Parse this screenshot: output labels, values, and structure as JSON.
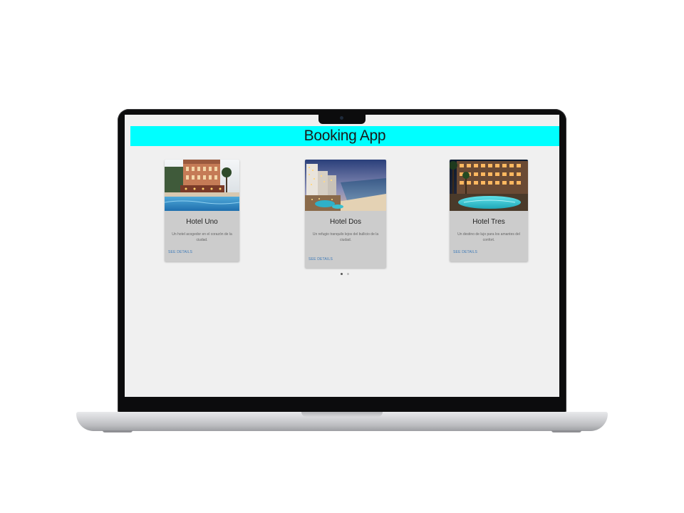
{
  "app": {
    "title": "Booking App"
  },
  "hotels": [
    {
      "name": "Hotel Uno",
      "description": "Un hotel acogedor en el corazón de la ciudad.",
      "action": "SEE DETAILS"
    },
    {
      "name": "Hotel Dos",
      "description": "Un refugio tranquilo lejos del bullicio de la ciudad.",
      "action": "SEE DETAILS"
    },
    {
      "name": "Hotel Tres",
      "description": "Un destino de lujo para los amantes del confort.",
      "action": "SEE DETAILS"
    }
  ],
  "carousel": {
    "pages": 2,
    "active_page": 1
  },
  "colors": {
    "header_background": "#00ffff",
    "card_background": "#cccccc",
    "page_background": "#f0f0f0",
    "link": "#3d7ab8"
  }
}
